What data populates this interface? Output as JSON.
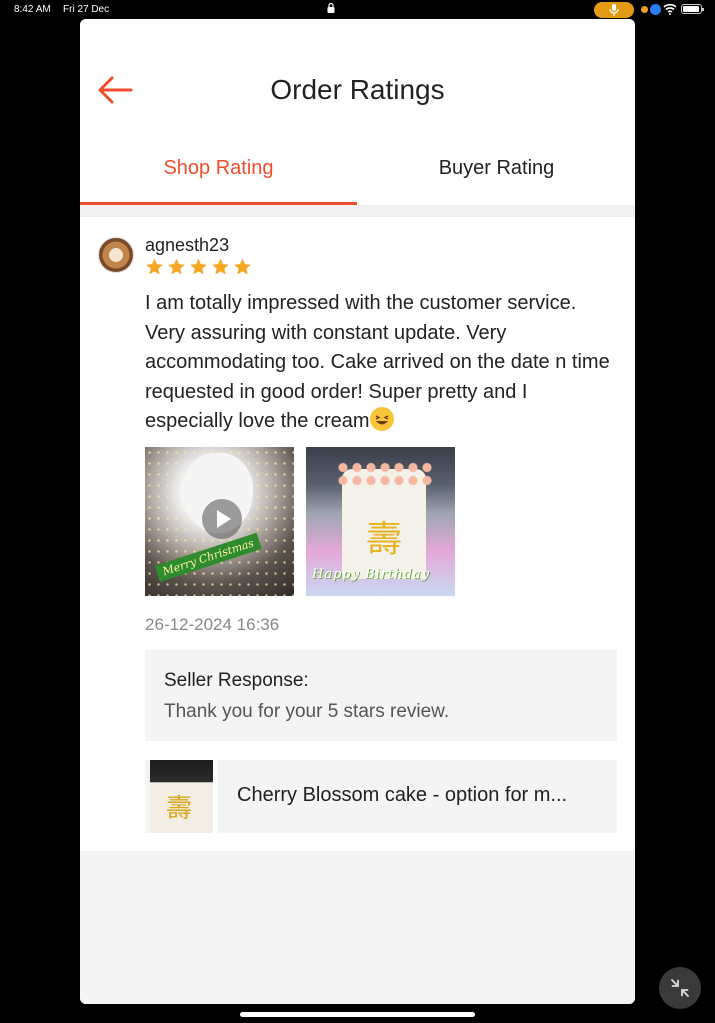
{
  "status_bar": {
    "time": "8:42 AM",
    "date": "Fri 27 Dec",
    "icons": [
      "lock-icon",
      "microphone-icon",
      "location-icon",
      "wifi-icon",
      "battery-icon"
    ]
  },
  "header": {
    "title": "Order Ratings",
    "back_icon": "back-arrow-icon"
  },
  "tabs": [
    {
      "label": "Shop Rating",
      "active": true
    },
    {
      "label": "Buyer Rating",
      "active": false
    }
  ],
  "review": {
    "username": "agnesth23",
    "rating": 5,
    "text": "I am totally impressed with the customer service. Very assuring with constant update. Very accommodating too. Cake arrived on the date n time requested in good order! Super pretty and I especially love the cream",
    "media": [
      {
        "type": "video",
        "caption": "Merry Christmas"
      },
      {
        "type": "photo",
        "caption": "Happy Birthday"
      }
    ],
    "timestamp": "26-12-2024 16:36",
    "seller_response": {
      "title": "Seller Response:",
      "text": "Thank you for your 5 stars review."
    },
    "product": {
      "name": "Cherry Blossom cake - option for m..."
    }
  },
  "colors": {
    "accent": "#ee4d2d",
    "star": "#f6a623",
    "text": "#222222",
    "muted": "#888888"
  }
}
